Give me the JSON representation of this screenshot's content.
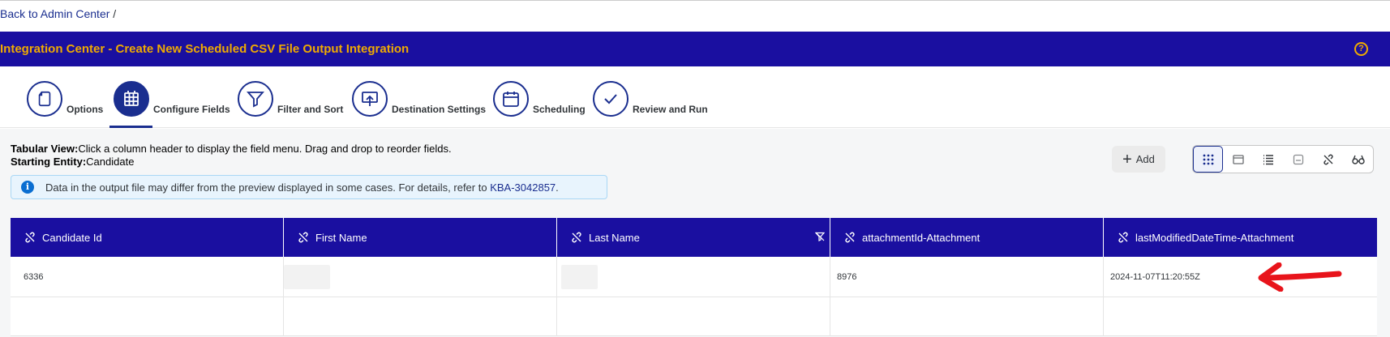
{
  "breadcrumb": {
    "link": "Back to Admin Center",
    "separator": "/"
  },
  "header": {
    "title": "Integration Center - Create New Scheduled CSV File Output Integration",
    "help": "?"
  },
  "steps": [
    {
      "label": "Options",
      "icon": "document-icon"
    },
    {
      "label": "Configure Fields",
      "icon": "table-grid-icon",
      "active": true
    },
    {
      "label": "Filter and Sort",
      "icon": "filter-icon"
    },
    {
      "label": "Destination Settings",
      "icon": "upload-icon"
    },
    {
      "label": "Scheduling",
      "icon": "calendar-icon"
    },
    {
      "label": "Review and Run",
      "icon": "checkmark-icon"
    }
  ],
  "info": {
    "tabular_label": "Tabular View:",
    "tabular_text": "Click a column header to display the field menu. Drag and drop to reorder fields.",
    "entity_label": "Starting Entity:",
    "entity_value": "Candidate",
    "banner_text": "Data in the output file may differ from the preview displayed in some cases. For details, refer to ",
    "banner_link": "KBA-3042857",
    "banner_end": "."
  },
  "toolbar": {
    "add_label": "Add",
    "view_buttons": [
      "grid-view-icon",
      "single-panel-icon",
      "list-view-icon",
      "collapse-icon",
      "unlink-icon",
      "glasses-icon"
    ],
    "selected_view": "grid-view-icon"
  },
  "table": {
    "columns": [
      "Candidate Id",
      "First Name",
      "Last Name",
      "attachmentId-Attachment",
      "lastModifiedDateTime-Attachment"
    ],
    "filtered_column": "Last Name",
    "rows": [
      [
        "6336",
        "",
        "",
        "8976",
        "2024-11-07T11:20:55Z"
      ],
      [
        "",
        "",
        "",
        "",
        ""
      ]
    ]
  },
  "colors": {
    "header_bg": "#1a0fa0",
    "title_color": "#f0ab00",
    "accent": "#1a2e8f",
    "arrow": "#e8141b"
  }
}
